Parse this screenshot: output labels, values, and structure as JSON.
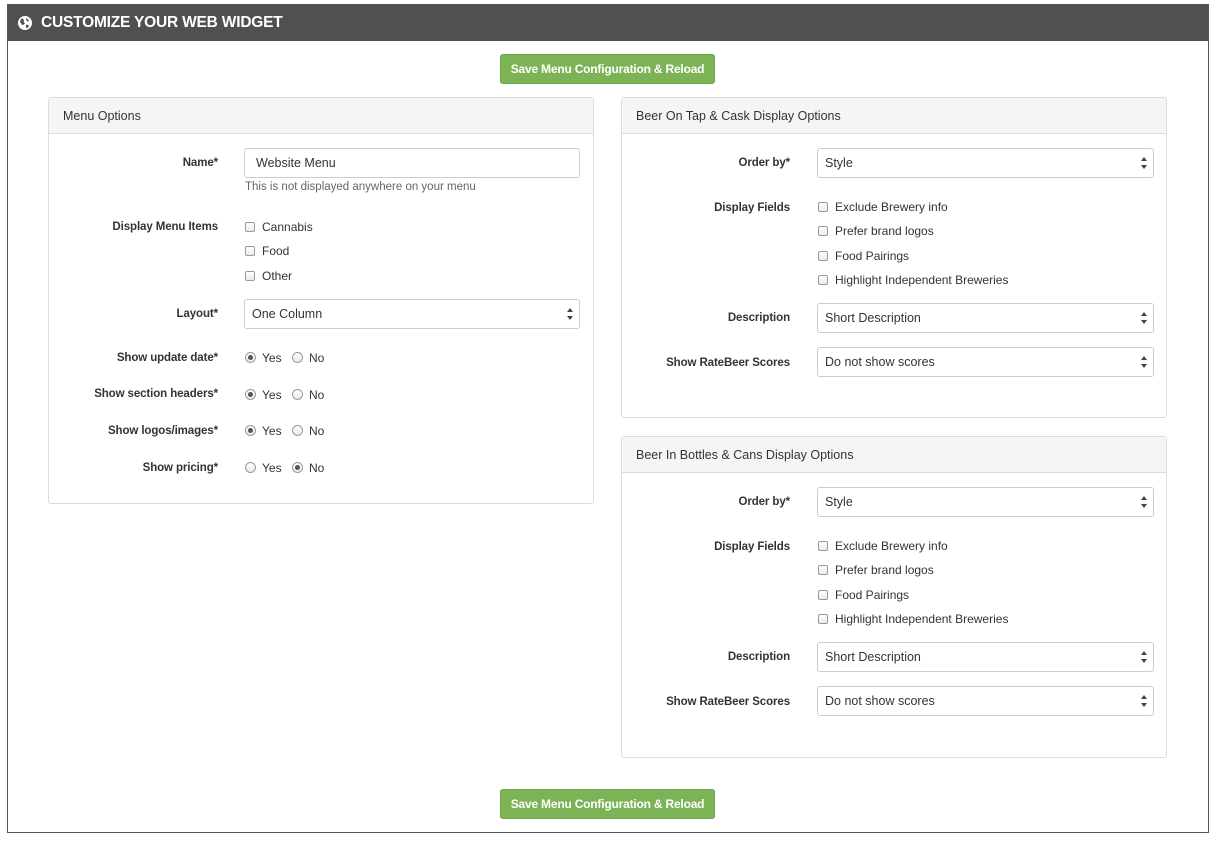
{
  "header": {
    "title": "CUSTOMIZE YOUR WEB WIDGET",
    "icon": "globe-icon"
  },
  "buttons": {
    "save_top": "Save Menu Configuration & Reload",
    "save_bottom": "Save Menu Configuration & Reload"
  },
  "colors": {
    "header_bg": "#505050",
    "save_button": "#7cb356",
    "panel_head_bg": "#f5f5f5"
  },
  "menu_options": {
    "title": "Menu Options",
    "name": {
      "label": "Name*",
      "value": "Website Menu",
      "help": "This is not displayed anywhere on your menu"
    },
    "display_items": {
      "label": "Display Menu Items",
      "options": [
        "Cannabis",
        "Food",
        "Other"
      ]
    },
    "layout": {
      "label": "Layout*",
      "value": "One Column"
    },
    "show_update_date": {
      "label": "Show update date*",
      "yes": "Yes",
      "no": "No",
      "selected": "Yes"
    },
    "show_section_headers": {
      "label": "Show section headers*",
      "yes": "Yes",
      "no": "No",
      "selected": "Yes"
    },
    "show_logos": {
      "label": "Show logos/images*",
      "yes": "Yes",
      "no": "No",
      "selected": "Yes"
    },
    "show_pricing": {
      "label": "Show pricing*",
      "yes": "Yes",
      "no": "No",
      "selected": "No"
    }
  },
  "tap_options": {
    "title": "Beer On Tap & Cask Display Options",
    "order_by": {
      "label": "Order by*",
      "value": "Style"
    },
    "display_fields": {
      "label": "Display Fields",
      "options": [
        "Exclude Brewery info",
        "Prefer brand logos",
        "Food Pairings",
        "Highlight Independent Breweries"
      ]
    },
    "description": {
      "label": "Description",
      "value": "Short Description"
    },
    "ratebeer": {
      "label": "Show RateBeer Scores",
      "value": "Do not show scores"
    }
  },
  "bottle_options": {
    "title": "Beer In Bottles & Cans Display Options",
    "order_by": {
      "label": "Order by*",
      "value": "Style"
    },
    "display_fields": {
      "label": "Display Fields",
      "options": [
        "Exclude Brewery info",
        "Prefer brand logos",
        "Food Pairings",
        "Highlight Independent Breweries"
      ]
    },
    "description": {
      "label": "Description",
      "value": "Short Description"
    },
    "ratebeer": {
      "label": "Show RateBeer Scores",
      "value": "Do not show scores"
    }
  }
}
